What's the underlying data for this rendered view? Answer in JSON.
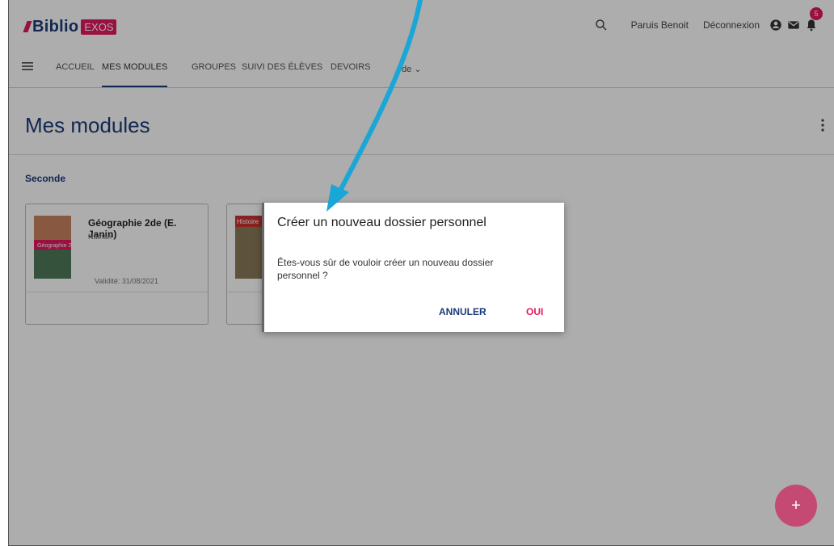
{
  "header": {
    "logo_text": "Biblio",
    "logo_badge": "EXOS",
    "user_name": "Paruis Benoit",
    "logout_label": "Déconnexion",
    "notification_count": "5"
  },
  "nav": {
    "items": [
      {
        "label": "ACCUEIL"
      },
      {
        "label": "MES MODULES"
      },
      {
        "label": "GROUPES"
      },
      {
        "label": "SUIVI DES ÉLÈVES"
      },
      {
        "label": "DEVOIRS"
      }
    ],
    "partial_label": "de"
  },
  "page": {
    "title": "Mes modules",
    "section": "Seconde"
  },
  "cards": [
    {
      "title": "Géographie 2de (E. Janin)",
      "publisher": "Nathan",
      "validity": "Validité: 31/08/2021"
    },
    {
      "cover_label": "Histoire"
    }
  ],
  "dialog": {
    "title": "Créer un nouveau dossier personnel",
    "message": "Êtes-vous sûr de vouloir créer un nouveau dossier personnel ?",
    "cancel_label": "ANNULER",
    "ok_label": "OUI"
  },
  "fab": {
    "label": "+"
  },
  "colors": {
    "brand_blue": "#1b3a7a",
    "brand_pink": "#e4195f",
    "annotation_arrow": "#1aa6d6"
  }
}
